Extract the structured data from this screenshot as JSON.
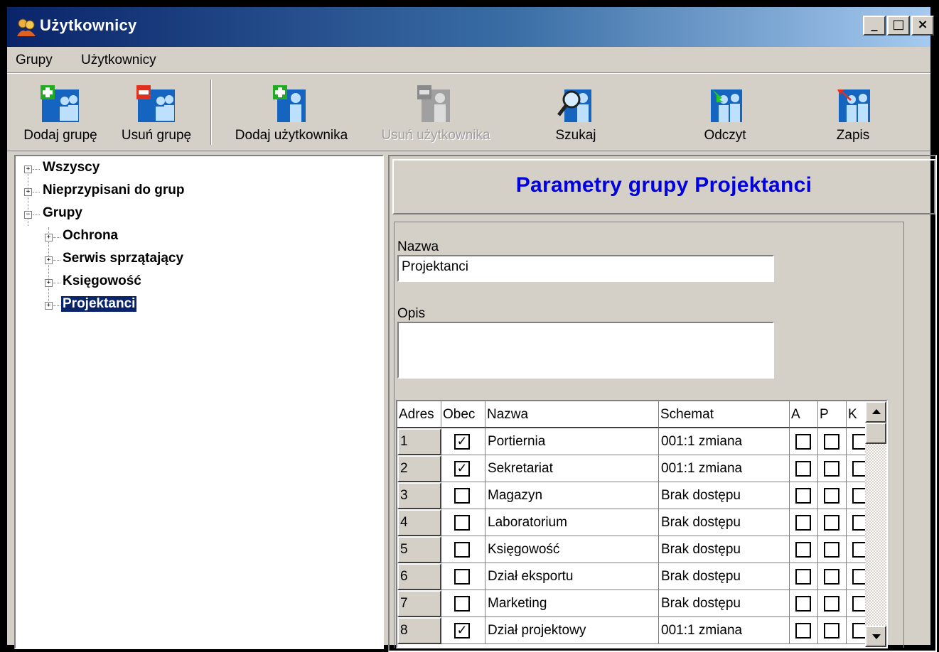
{
  "window": {
    "title": "Użytkownicy"
  },
  "menu": [
    {
      "label": "Grupy"
    },
    {
      "label": "Użytkownicy"
    }
  ],
  "toolbar": {
    "add_group": "Dodaj grupę",
    "remove_group": "Usuń grupę",
    "add_user": "Dodaj użytkownika",
    "remove_user": "Usuń użytkownika",
    "search": "Szukaj",
    "read": "Odczyt",
    "save": "Zapis"
  },
  "tree": {
    "items": [
      {
        "label": "Wszyscy",
        "expanded": false
      },
      {
        "label": "Nieprzypisani do grup",
        "expanded": false
      },
      {
        "label": "Grupy",
        "expanded": true
      },
      {
        "label": "Ochrona",
        "expanded": false
      },
      {
        "label": "Serwis sprzątający",
        "expanded": false
      },
      {
        "label": "Księgowość",
        "expanded": false
      },
      {
        "label": "Projektanci",
        "expanded": false,
        "selected": true
      }
    ]
  },
  "panel": {
    "title": "Parametry grupy Projektanci",
    "name_label": "Nazwa",
    "name_value": "Projektanci",
    "desc_label": "Opis",
    "desc_value": ""
  },
  "grid": {
    "headers": [
      "Adres",
      "Obec",
      "Nazwa",
      "Schemat",
      "A",
      "P",
      "K"
    ],
    "rows": [
      {
        "addr": "1",
        "present": true,
        "name": "Portiernia",
        "schema": "001:1 zmiana",
        "a": false,
        "p": false,
        "k": false
      },
      {
        "addr": "2",
        "present": true,
        "name": "Sekretariat",
        "schema": "001:1 zmiana",
        "a": false,
        "p": false,
        "k": false
      },
      {
        "addr": "3",
        "present": false,
        "name": "Magazyn",
        "schema": "Brak dostępu",
        "a": false,
        "p": false,
        "k": false
      },
      {
        "addr": "4",
        "present": false,
        "name": "Laboratorium",
        "schema": "Brak dostępu",
        "a": false,
        "p": false,
        "k": false
      },
      {
        "addr": "5",
        "present": false,
        "name": "Księgowość",
        "schema": "Brak dostępu",
        "a": false,
        "p": false,
        "k": false
      },
      {
        "addr": "6",
        "present": false,
        "name": "Dział eksportu",
        "schema": "Brak dostępu",
        "a": false,
        "p": false,
        "k": false
      },
      {
        "addr": "7",
        "present": false,
        "name": "Marketing",
        "schema": "Brak dostępu",
        "a": false,
        "p": false,
        "k": false
      },
      {
        "addr": "8",
        "present": true,
        "name": "Dział projektowy",
        "schema": "001:1 zmiana",
        "a": false,
        "p": false,
        "k": false
      }
    ]
  },
  "colors": {
    "title_blue": "#0a246a",
    "panel_title": "#0000e0",
    "face": "#d4d0c8"
  }
}
